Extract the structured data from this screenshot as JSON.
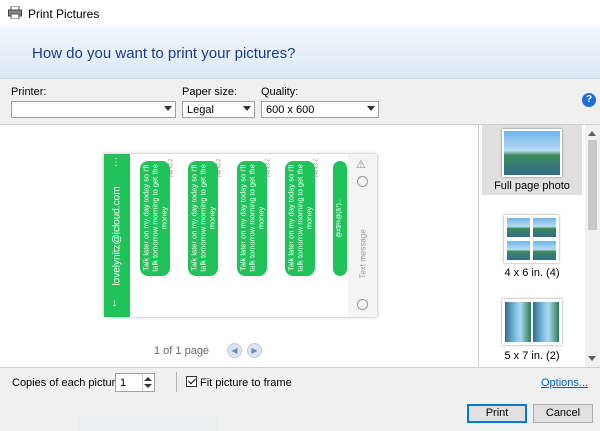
{
  "window": {
    "title": "Print Pictures",
    "icon": "printer-icon"
  },
  "header": {
    "question": "How do you want to print your pictures?"
  },
  "options": {
    "printer_label": "Printer:",
    "printer_value": "",
    "paper_label": "Paper size:",
    "paper_value": "Legal",
    "quality_label": "Quality:",
    "quality_value": "600 x 600",
    "help_glyph": "?"
  },
  "preview": {
    "email": "lovelynitz@icloud.com",
    "message": "Talk later on my day today so I'll talk tomorrow morning to get the money",
    "bubble_time": "2:23 PM",
    "last_bubble": "@#$%@(&*)...",
    "text_placeholder": "Text message",
    "pager": "1 of 1 page",
    "prev_glyph": "◀",
    "next_glyph": "▶"
  },
  "layouts": [
    {
      "label": "Full page photo",
      "selected": true
    },
    {
      "label": "4 x 6 in. (4)",
      "selected": false
    },
    {
      "label": "5 x 7 in. (2)",
      "selected": false
    }
  ],
  "footer": {
    "copies_label": "Copies of each picture:",
    "copies_value": "1",
    "fit_label": "Fit picture to frame",
    "fit_checked": true,
    "options_link": "Options...",
    "print_button": "Print",
    "cancel_button": "Cancel"
  },
  "colors": {
    "accent": "#0078d7",
    "sms_green": "#1fc35a",
    "header_text": "#1e3a8a"
  }
}
